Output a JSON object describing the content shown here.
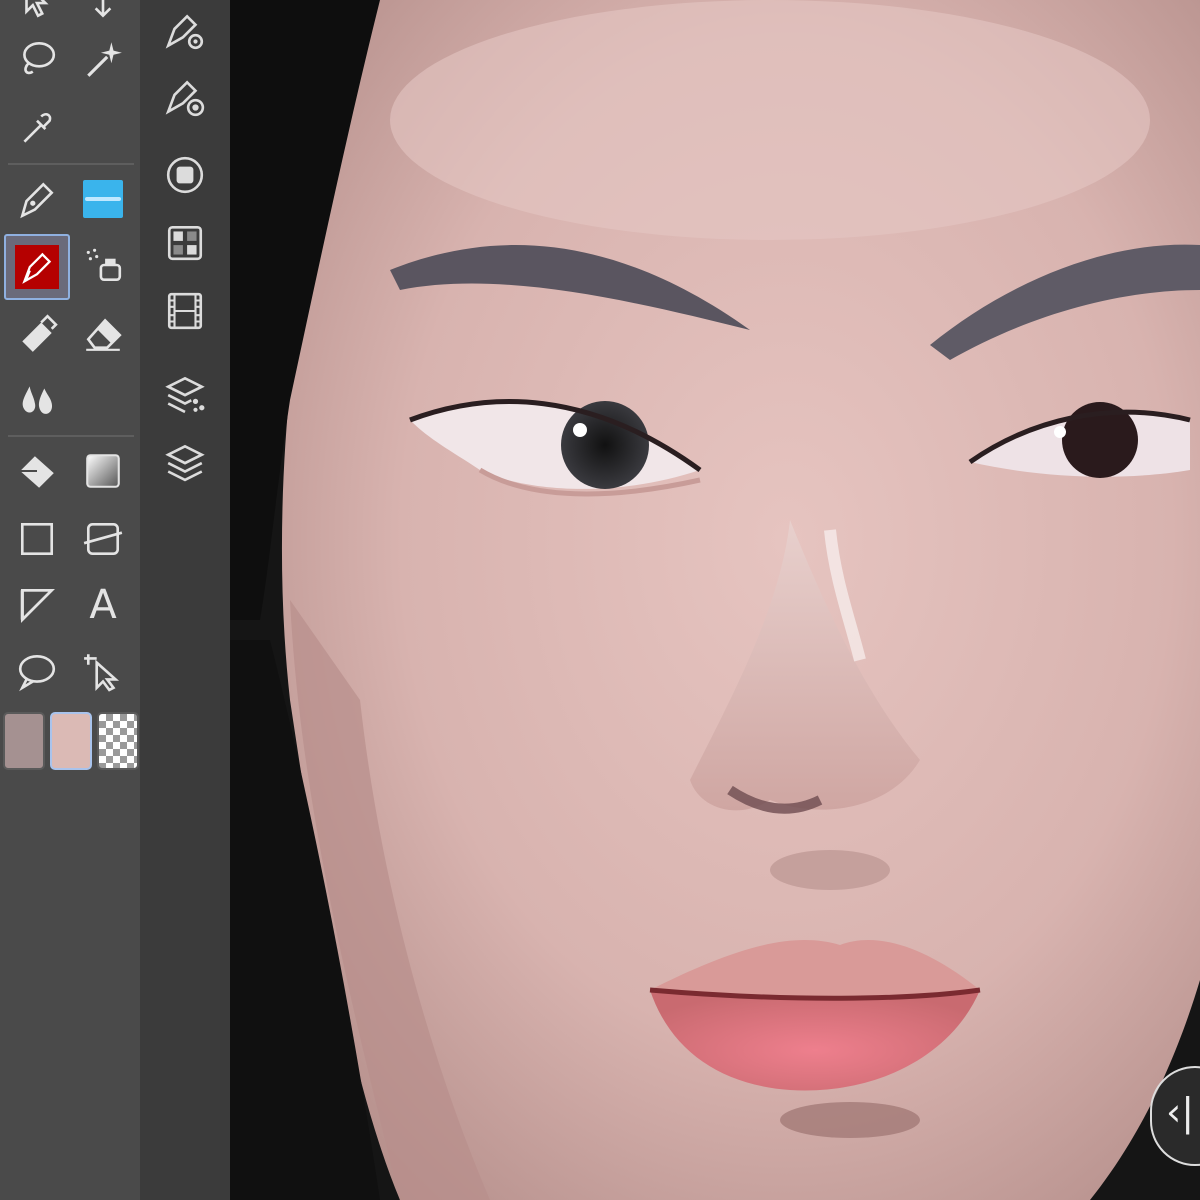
{
  "toolbar": {
    "tools": [
      {
        "name": "move-layer",
        "icon": "move-arrow-icon"
      },
      {
        "name": "operation",
        "icon": "down-arrow-icon"
      },
      {
        "name": "lasso",
        "icon": "lasso-icon"
      },
      {
        "name": "auto-select",
        "icon": "magic-wand-icon"
      },
      {
        "name": "eyedropper",
        "icon": "eyedropper-icon"
      },
      {
        "name": "pen",
        "icon": "pen-nib-icon"
      },
      {
        "name": "watercolor",
        "icon": "watercolor-brush-icon"
      },
      {
        "name": "brush",
        "icon": "brush-icon",
        "active": true
      },
      {
        "name": "airbrush",
        "icon": "airbrush-icon"
      },
      {
        "name": "decoration",
        "icon": "decoration-icon"
      },
      {
        "name": "eraser",
        "icon": "eraser-icon"
      },
      {
        "name": "blend",
        "icon": "blend-drops-icon"
      },
      {
        "name": "fill",
        "icon": "fill-bucket-icon"
      },
      {
        "name": "gradient",
        "icon": "gradient-icon"
      },
      {
        "name": "figure",
        "icon": "rectangle-icon"
      },
      {
        "name": "ruler",
        "icon": "ruler-icon"
      },
      {
        "name": "frame-border",
        "icon": "frame-border-icon"
      },
      {
        "name": "text",
        "icon": "text-icon",
        "label": "A"
      },
      {
        "name": "balloon",
        "icon": "speech-balloon-icon"
      },
      {
        "name": "correct-line",
        "icon": "correct-line-icon"
      }
    ],
    "colors": {
      "main": "#a59191",
      "sub": "#dbbab5",
      "active_tool_bg": "#b50000",
      "watercolor_preview": "#3ab4ec"
    }
  },
  "side_panel": {
    "icons": [
      "tool-property-icon",
      "brush-size-icon",
      "color-circle-icon",
      "color-set-icon",
      "timeline-icon",
      "layer-property-icon",
      "layers-icon"
    ]
  },
  "canvas": {
    "skin_color": "#dbb7b3",
    "hair_color": "#151515",
    "lip_color": "#d96a78"
  },
  "collapse_button": {
    "label": "‹|"
  }
}
